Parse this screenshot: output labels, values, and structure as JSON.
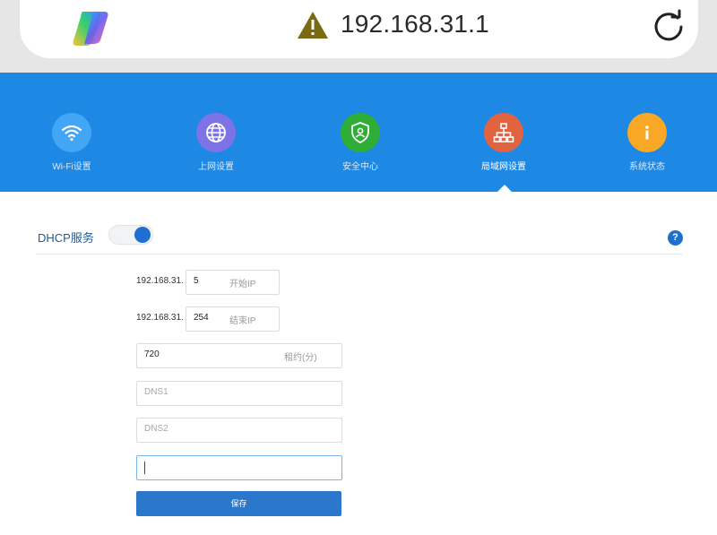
{
  "browser": {
    "url": "192.168.31.1",
    "icons": {
      "app": "copilot-logo-icon",
      "warning": "warning-triangle-icon",
      "reload": "reload-icon"
    }
  },
  "nav": {
    "items": [
      {
        "label": "Wi-Fi设置",
        "icon": "wifi-icon",
        "color": "#42a5f5"
      },
      {
        "label": "上网设置",
        "icon": "globe-icon",
        "color": "#7e73e6"
      },
      {
        "label": "安全中心",
        "icon": "shield-icon",
        "color": "#2eae37"
      },
      {
        "label": "局域网设置",
        "icon": "network-icon",
        "color": "#e2633f",
        "active": true
      },
      {
        "label": "系统状态",
        "icon": "info-icon",
        "color": "#f9a825"
      }
    ]
  },
  "dhcp": {
    "label": "DHCP服务",
    "enabled": true,
    "help": "?",
    "start": {
      "prefix": "192.168.31.",
      "value": "5",
      "hint": "开始IP"
    },
    "end": {
      "prefix": "192.168.31.",
      "value": "254",
      "hint": "结束IP"
    },
    "lease": {
      "value": "720",
      "hint": "租约(分)"
    },
    "dns1": {
      "placeholder": "DNS1"
    },
    "dns2": {
      "placeholder": "DNS2"
    },
    "save_label": "保存"
  },
  "colors": {
    "band": "#1e88e5",
    "accent": "#1e6fd0",
    "button": "#2a77cc"
  }
}
